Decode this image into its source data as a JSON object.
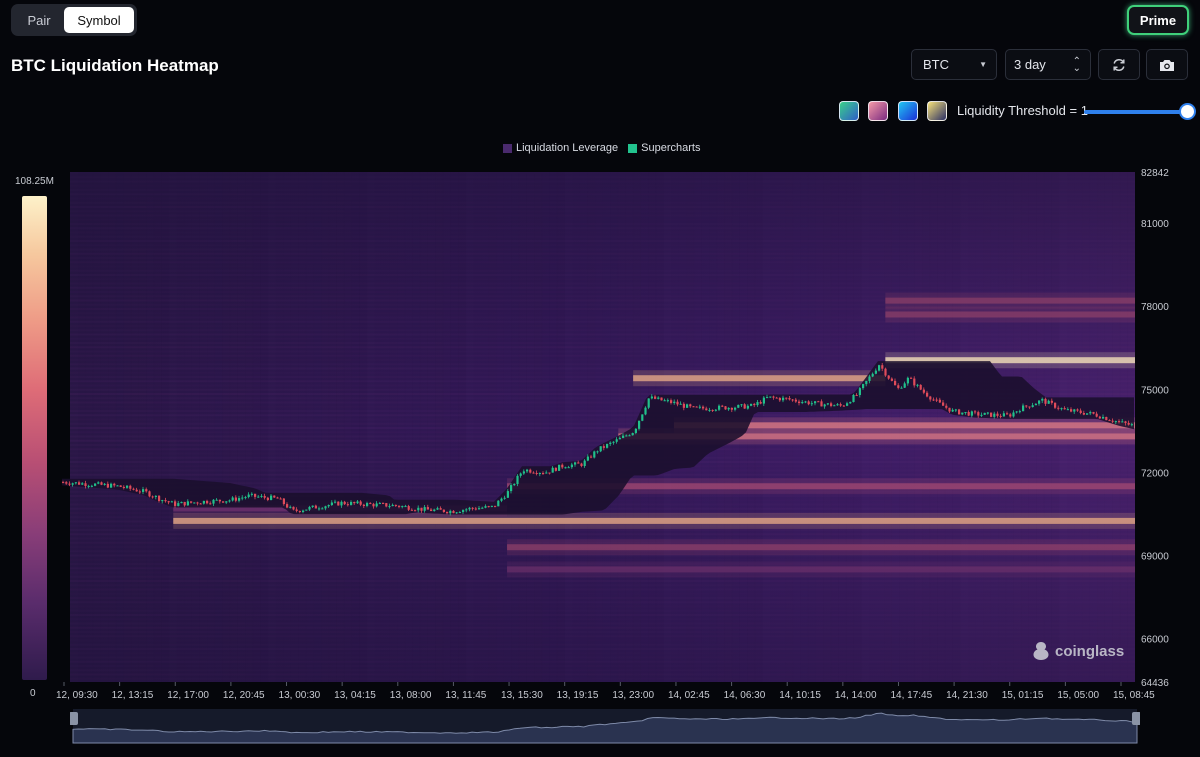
{
  "header": {
    "tabs": [
      {
        "label": "Pair"
      },
      {
        "label": "Symbol"
      }
    ],
    "prime_label": "Prime",
    "title": "BTC Liquidation Heatmap"
  },
  "controls": {
    "coin_select": "BTC",
    "range_select": "3 day",
    "refresh_icon": "refresh-icon",
    "camera_icon": "camera-icon",
    "palettes": [
      {
        "name": "palette-green-teal",
        "from": "#3ad08a",
        "to": "#2f5ec8"
      },
      {
        "name": "palette-pink-purple",
        "from": "#f59aa8",
        "to": "#7a2a80"
      },
      {
        "name": "palette-blue",
        "from": "#22c6f2",
        "to": "#1b2fd8"
      },
      {
        "name": "palette-yellow-navy",
        "from": "#f7e27a",
        "to": "#2a2e64"
      }
    ],
    "threshold_label": "Liquidity Threshold = 1",
    "threshold_value": 1
  },
  "legend": [
    {
      "label": "Liquidation Leverage",
      "color": "#4a2a6e"
    },
    {
      "label": "Supercharts",
      "color": "#22c38e"
    }
  ],
  "scale": {
    "max_label": "108.25M",
    "min_label": "0"
  },
  "brand": "coinglass",
  "chart_data": {
    "type": "heatmap",
    "title": "BTC Liquidation Heatmap",
    "ylim": [
      64436,
      82842
    ],
    "y_ticks": [
      "82842",
      "81000",
      "78000",
      "75000",
      "72000",
      "69000",
      "66000",
      "64436"
    ],
    "x_ticks": [
      "12, 09:30",
      "12, 13:15",
      "12, 17:00",
      "12, 20:45",
      "13, 00:30",
      "13, 04:15",
      "13, 08:00",
      "13, 11:45",
      "13, 15:30",
      "13, 19:15",
      "13, 23:00",
      "14, 02:45",
      "14, 06:30",
      "14, 10:15",
      "14, 14:00",
      "14, 17:45",
      "14, 21:30",
      "15, 01:15",
      "15, 05:00",
      "15, 08:45"
    ],
    "color_scale": {
      "min": 0,
      "max": 108250000,
      "unit": "USD"
    },
    "liquidation_bands": [
      {
        "price": 70250,
        "start": "12, 17:00",
        "end": "15, 10:00",
        "intensity": 0.9
      },
      {
        "price": 70700,
        "start": "12, 17:00",
        "end": "13, 15:30",
        "intensity": 0.35
      },
      {
        "price": 71500,
        "start": "13, 15:30",
        "end": "15, 10:00",
        "intensity": 0.45
      },
      {
        "price": 73300,
        "start": "13, 23:00",
        "end": "15, 10:00",
        "intensity": 0.55
      },
      {
        "price": 73700,
        "start": "14, 02:45",
        "end": "15, 10:00",
        "intensity": 0.6
      },
      {
        "price": 75400,
        "start": "14, 00:00",
        "end": "14, 17:00",
        "intensity": 0.75
      },
      {
        "price": 76050,
        "start": "14, 17:00",
        "end": "15, 10:00",
        "intensity": 1.0
      },
      {
        "price": 78200,
        "start": "14, 17:00",
        "end": "15, 10:00",
        "intensity": 0.45
      },
      {
        "price": 77700,
        "start": "14, 17:00",
        "end": "15, 10:00",
        "intensity": 0.4
      },
      {
        "price": 68500,
        "start": "13, 15:30",
        "end": "15, 10:00",
        "intensity": 0.35
      },
      {
        "price": 69300,
        "start": "13, 15:30",
        "end": "15, 10:00",
        "intensity": 0.4
      }
    ],
    "price_series": {
      "name": "Supercharts",
      "points": [
        [
          "12, 09:30",
          71650
        ],
        [
          "12, 13:15",
          71500
        ],
        [
          "12, 15:00",
          71300
        ],
        [
          "12, 16:00",
          71050
        ],
        [
          "12, 17:00",
          70850
        ],
        [
          "12, 19:00",
          70950
        ],
        [
          "12, 20:45",
          71000
        ],
        [
          "12, 22:00",
          71150
        ],
        [
          "13, 00:00",
          71050
        ],
        [
          "13, 01:00",
          70600
        ],
        [
          "13, 02:00",
          70700
        ],
        [
          "13, 04:15",
          70900
        ],
        [
          "13, 06:00",
          70850
        ],
        [
          "13, 08:00",
          70800
        ],
        [
          "13, 10:00",
          70650
        ],
        [
          "13, 11:45",
          70600
        ],
        [
          "13, 13:00",
          70700
        ],
        [
          "13, 14:30",
          70750
        ],
        [
          "13, 15:30",
          71300
        ],
        [
          "13, 16:30",
          72100
        ],
        [
          "13, 18:00",
          72000
        ],
        [
          "13, 19:15",
          72250
        ],
        [
          "13, 20:30",
          72300
        ],
        [
          "13, 21:30",
          72800
        ],
        [
          "13, 23:00",
          73200
        ],
        [
          "14, 00:00",
          73500
        ],
        [
          "14, 01:00",
          74700
        ],
        [
          "14, 02:45",
          74500
        ],
        [
          "14, 04:00",
          74300
        ],
        [
          "14, 06:30",
          74350
        ],
        [
          "14, 08:00",
          74400
        ],
        [
          "14, 09:00",
          74700
        ],
        [
          "14, 10:15",
          74650
        ],
        [
          "14, 12:00",
          74500
        ],
        [
          "14, 14:00",
          74400
        ],
        [
          "14, 15:00",
          74800
        ],
        [
          "14, 16:30",
          75900
        ],
        [
          "14, 17:45",
          75000
        ],
        [
          "14, 18:30",
          75400
        ],
        [
          "14, 19:30",
          74900
        ],
        [
          "14, 20:30",
          74500
        ],
        [
          "14, 21:30",
          74200
        ],
        [
          "14, 23:00",
          74100
        ],
        [
          "15, 01:15",
          74050
        ],
        [
          "15, 02:00",
          74300
        ],
        [
          "15, 03:30",
          74600
        ],
        [
          "15, 05:00",
          74250
        ],
        [
          "15, 07:00",
          74100
        ],
        [
          "15, 08:45",
          73800
        ],
        [
          "15, 10:00",
          73650
        ]
      ]
    }
  }
}
